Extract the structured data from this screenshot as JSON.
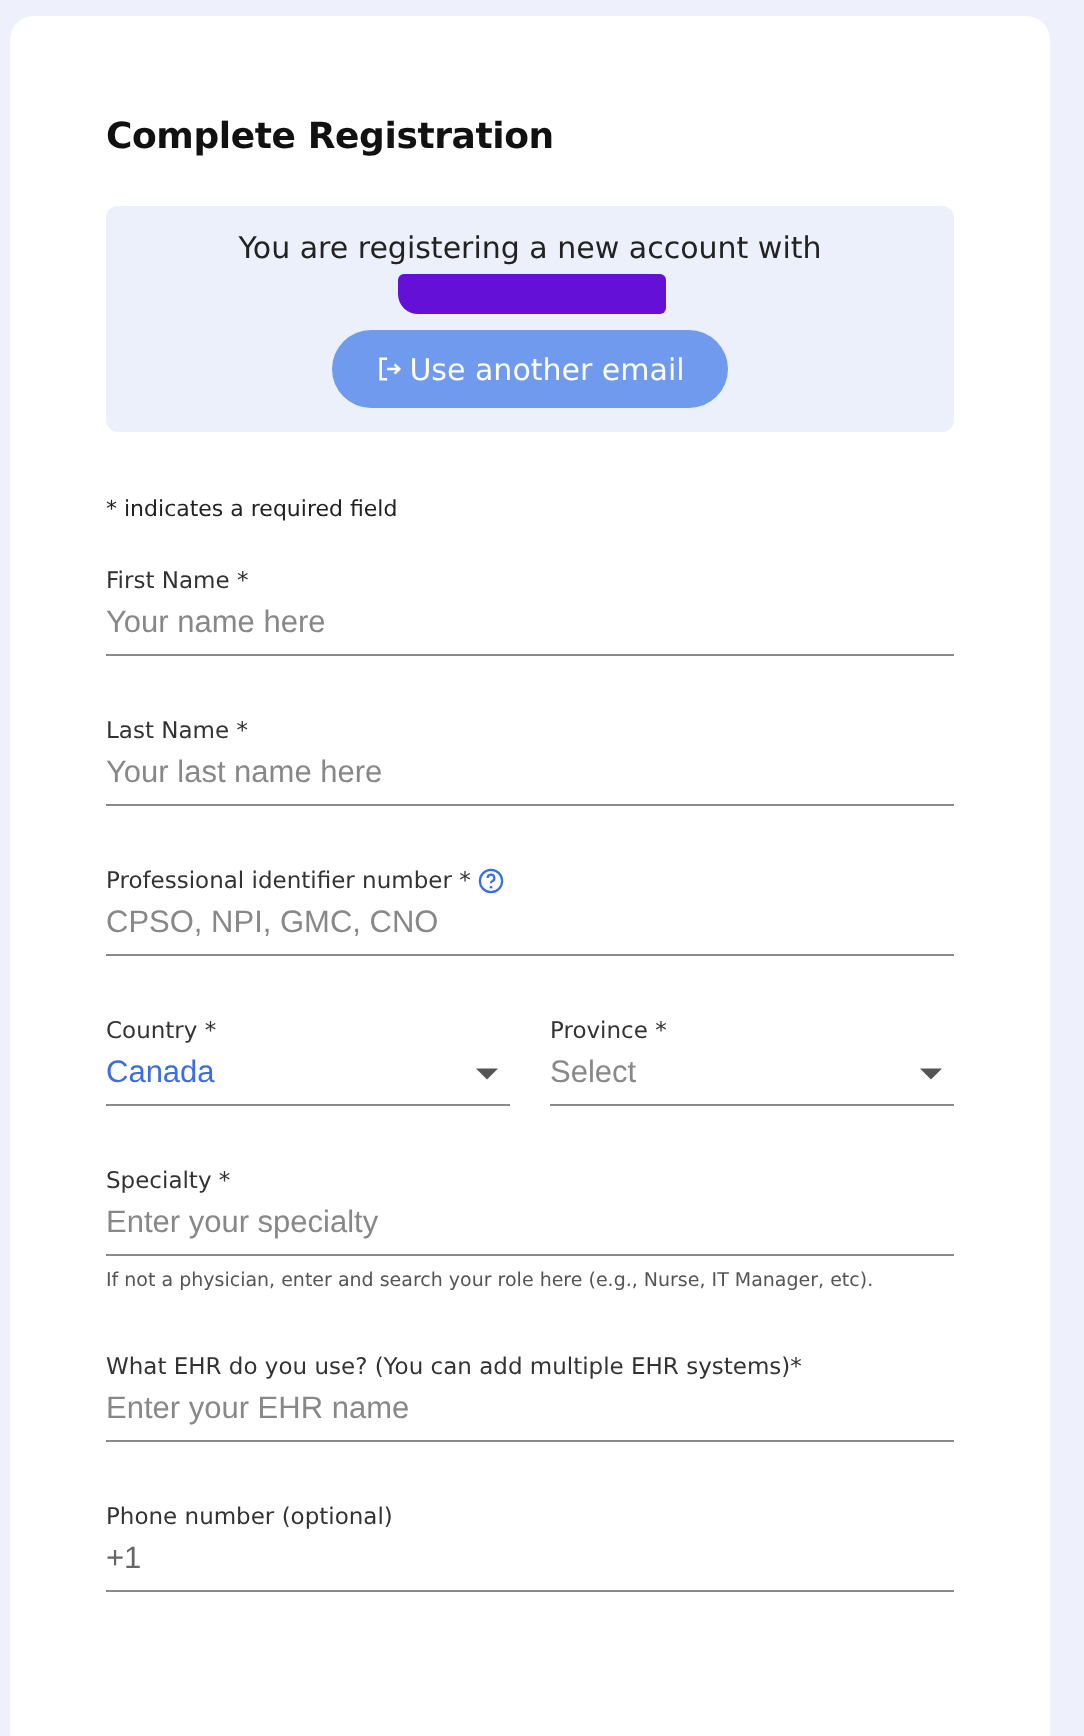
{
  "title": "Complete Registration",
  "notice": {
    "text": "You are registering a new account with",
    "email_redacted": true,
    "button": "Use another email"
  },
  "required_note": "* indicates a required field",
  "fields": [
    {
      "kind": "text",
      "label": "First Name *",
      "placeholder": "Your name here"
    },
    {
      "kind": "text",
      "label": "Last Name *",
      "placeholder": "Your last name here"
    },
    {
      "kind": "text",
      "label": "Professional identifier number *",
      "placeholder": "CPSO, NPI, GMC, CNO",
      "help": true
    },
    {
      "kind": "pair",
      "items": [
        {
          "kind": "select",
          "label": "Country *",
          "value": "Canada"
        },
        {
          "kind": "select",
          "label": "Province *",
          "placeholder": "Select"
        }
      ]
    },
    {
      "kind": "text",
      "label": "Specialty *",
      "placeholder": "Enter your specialty",
      "hint": "If not a physician, enter and search your role here (e.g., Nurse, IT Manager, etc)."
    },
    {
      "kind": "text",
      "label": "What EHR do you use? (You can add multiple EHR systems)*",
      "placeholder": "Enter your EHR name"
    },
    {
      "kind": "text",
      "label": "Phone number (optional)",
      "value": "+1"
    }
  ]
}
